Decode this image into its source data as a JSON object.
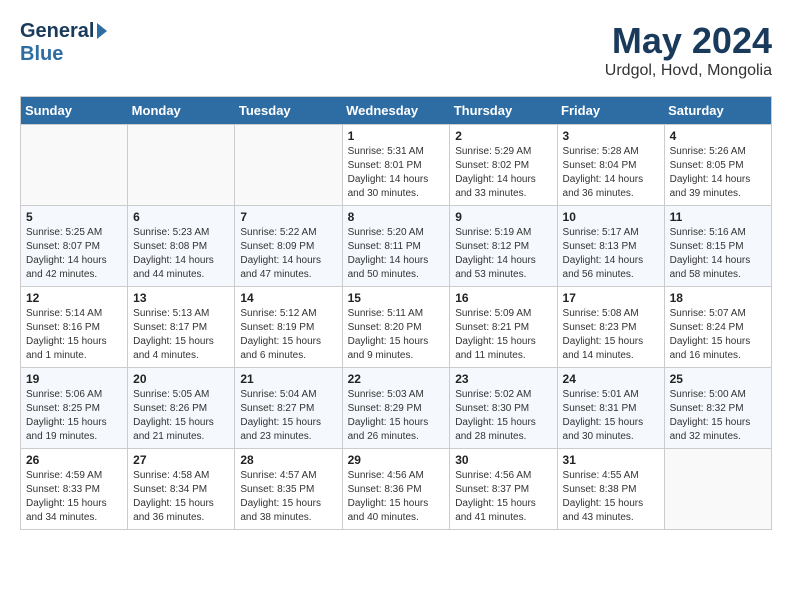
{
  "header": {
    "logo_general": "General",
    "logo_blue": "Blue",
    "month_title": "May 2024",
    "location": "Urdgol, Hovd, Mongolia"
  },
  "weekdays": [
    "Sunday",
    "Monday",
    "Tuesday",
    "Wednesday",
    "Thursday",
    "Friday",
    "Saturday"
  ],
  "weeks": [
    [
      {
        "day": "",
        "sunrise": "",
        "sunset": "",
        "daylight": ""
      },
      {
        "day": "",
        "sunrise": "",
        "sunset": "",
        "daylight": ""
      },
      {
        "day": "",
        "sunrise": "",
        "sunset": "",
        "daylight": ""
      },
      {
        "day": "1",
        "sunrise": "Sunrise: 5:31 AM",
        "sunset": "Sunset: 8:01 PM",
        "daylight": "Daylight: 14 hours and 30 minutes."
      },
      {
        "day": "2",
        "sunrise": "Sunrise: 5:29 AM",
        "sunset": "Sunset: 8:02 PM",
        "daylight": "Daylight: 14 hours and 33 minutes."
      },
      {
        "day": "3",
        "sunrise": "Sunrise: 5:28 AM",
        "sunset": "Sunset: 8:04 PM",
        "daylight": "Daylight: 14 hours and 36 minutes."
      },
      {
        "day": "4",
        "sunrise": "Sunrise: 5:26 AM",
        "sunset": "Sunset: 8:05 PM",
        "daylight": "Daylight: 14 hours and 39 minutes."
      }
    ],
    [
      {
        "day": "5",
        "sunrise": "Sunrise: 5:25 AM",
        "sunset": "Sunset: 8:07 PM",
        "daylight": "Daylight: 14 hours and 42 minutes."
      },
      {
        "day": "6",
        "sunrise": "Sunrise: 5:23 AM",
        "sunset": "Sunset: 8:08 PM",
        "daylight": "Daylight: 14 hours and 44 minutes."
      },
      {
        "day": "7",
        "sunrise": "Sunrise: 5:22 AM",
        "sunset": "Sunset: 8:09 PM",
        "daylight": "Daylight: 14 hours and 47 minutes."
      },
      {
        "day": "8",
        "sunrise": "Sunrise: 5:20 AM",
        "sunset": "Sunset: 8:11 PM",
        "daylight": "Daylight: 14 hours and 50 minutes."
      },
      {
        "day": "9",
        "sunrise": "Sunrise: 5:19 AM",
        "sunset": "Sunset: 8:12 PM",
        "daylight": "Daylight: 14 hours and 53 minutes."
      },
      {
        "day": "10",
        "sunrise": "Sunrise: 5:17 AM",
        "sunset": "Sunset: 8:13 PM",
        "daylight": "Daylight: 14 hours and 56 minutes."
      },
      {
        "day": "11",
        "sunrise": "Sunrise: 5:16 AM",
        "sunset": "Sunset: 8:15 PM",
        "daylight": "Daylight: 14 hours and 58 minutes."
      }
    ],
    [
      {
        "day": "12",
        "sunrise": "Sunrise: 5:14 AM",
        "sunset": "Sunset: 8:16 PM",
        "daylight": "Daylight: 15 hours and 1 minute."
      },
      {
        "day": "13",
        "sunrise": "Sunrise: 5:13 AM",
        "sunset": "Sunset: 8:17 PM",
        "daylight": "Daylight: 15 hours and 4 minutes."
      },
      {
        "day": "14",
        "sunrise": "Sunrise: 5:12 AM",
        "sunset": "Sunset: 8:19 PM",
        "daylight": "Daylight: 15 hours and 6 minutes."
      },
      {
        "day": "15",
        "sunrise": "Sunrise: 5:11 AM",
        "sunset": "Sunset: 8:20 PM",
        "daylight": "Daylight: 15 hours and 9 minutes."
      },
      {
        "day": "16",
        "sunrise": "Sunrise: 5:09 AM",
        "sunset": "Sunset: 8:21 PM",
        "daylight": "Daylight: 15 hours and 11 minutes."
      },
      {
        "day": "17",
        "sunrise": "Sunrise: 5:08 AM",
        "sunset": "Sunset: 8:23 PM",
        "daylight": "Daylight: 15 hours and 14 minutes."
      },
      {
        "day": "18",
        "sunrise": "Sunrise: 5:07 AM",
        "sunset": "Sunset: 8:24 PM",
        "daylight": "Daylight: 15 hours and 16 minutes."
      }
    ],
    [
      {
        "day": "19",
        "sunrise": "Sunrise: 5:06 AM",
        "sunset": "Sunset: 8:25 PM",
        "daylight": "Daylight: 15 hours and 19 minutes."
      },
      {
        "day": "20",
        "sunrise": "Sunrise: 5:05 AM",
        "sunset": "Sunset: 8:26 PM",
        "daylight": "Daylight: 15 hours and 21 minutes."
      },
      {
        "day": "21",
        "sunrise": "Sunrise: 5:04 AM",
        "sunset": "Sunset: 8:27 PM",
        "daylight": "Daylight: 15 hours and 23 minutes."
      },
      {
        "day": "22",
        "sunrise": "Sunrise: 5:03 AM",
        "sunset": "Sunset: 8:29 PM",
        "daylight": "Daylight: 15 hours and 26 minutes."
      },
      {
        "day": "23",
        "sunrise": "Sunrise: 5:02 AM",
        "sunset": "Sunset: 8:30 PM",
        "daylight": "Daylight: 15 hours and 28 minutes."
      },
      {
        "day": "24",
        "sunrise": "Sunrise: 5:01 AM",
        "sunset": "Sunset: 8:31 PM",
        "daylight": "Daylight: 15 hours and 30 minutes."
      },
      {
        "day": "25",
        "sunrise": "Sunrise: 5:00 AM",
        "sunset": "Sunset: 8:32 PM",
        "daylight": "Daylight: 15 hours and 32 minutes."
      }
    ],
    [
      {
        "day": "26",
        "sunrise": "Sunrise: 4:59 AM",
        "sunset": "Sunset: 8:33 PM",
        "daylight": "Daylight: 15 hours and 34 minutes."
      },
      {
        "day": "27",
        "sunrise": "Sunrise: 4:58 AM",
        "sunset": "Sunset: 8:34 PM",
        "daylight": "Daylight: 15 hours and 36 minutes."
      },
      {
        "day": "28",
        "sunrise": "Sunrise: 4:57 AM",
        "sunset": "Sunset: 8:35 PM",
        "daylight": "Daylight: 15 hours and 38 minutes."
      },
      {
        "day": "29",
        "sunrise": "Sunrise: 4:56 AM",
        "sunset": "Sunset: 8:36 PM",
        "daylight": "Daylight: 15 hours and 40 minutes."
      },
      {
        "day": "30",
        "sunrise": "Sunrise: 4:56 AM",
        "sunset": "Sunset: 8:37 PM",
        "daylight": "Daylight: 15 hours and 41 minutes."
      },
      {
        "day": "31",
        "sunrise": "Sunrise: 4:55 AM",
        "sunset": "Sunset: 8:38 PM",
        "daylight": "Daylight: 15 hours and 43 minutes."
      },
      {
        "day": "",
        "sunrise": "",
        "sunset": "",
        "daylight": ""
      }
    ]
  ]
}
